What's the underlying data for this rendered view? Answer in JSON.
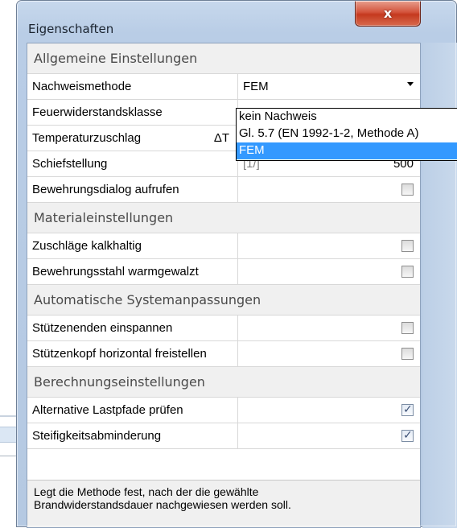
{
  "window": {
    "title": "Eigenschaften",
    "close_glyph": "x"
  },
  "sections": {
    "general": "Allgemeine Einstellungen",
    "material": "Materialeinstellungen",
    "auto": "Automatische Systemanpassungen",
    "calc": "Berechnungseinstellungen"
  },
  "rows": {
    "method": {
      "label": "Nachweismethode",
      "value": "FEM"
    },
    "fire_class": {
      "label": "Feuerwiderstandsklasse"
    },
    "temp": {
      "label": "Temperaturzuschlag",
      "symbol": "ΔT"
    },
    "tilt": {
      "label": "Schiefstellung",
      "unit": "[1/]",
      "value": "500"
    },
    "reinforcement_dialog": {
      "label": "Bewehrungsdialog aufrufen",
      "checked": false
    },
    "aggregates": {
      "label": "Zuschläge kalkhaltig",
      "checked": false
    },
    "steel": {
      "label": "Bewehrungsstahl warmgewalzt",
      "checked": false
    },
    "clamp": {
      "label": "Stützenenden einspannen",
      "checked": false
    },
    "release": {
      "label": "Stützenkopf horizontal freistellen",
      "checked": false
    },
    "alt_paths": {
      "label": "Alternative Lastpfade prüfen",
      "checked": true,
      "mark": "✓"
    },
    "stiffness": {
      "label": "Steifigkeitsabminderung",
      "checked": true,
      "mark": "✓"
    }
  },
  "dropdown": {
    "options": [
      "kein Nachweis",
      "Gl. 5.7 (EN 1992-1-2, Methode A)",
      "FEM"
    ],
    "selected": "FEM"
  },
  "description": {
    "line1": "Legt die Methode fest, nach der die gewählte",
    "line2": "Brandwiderstandsdauer nachgewiesen werden soll."
  },
  "colors": {
    "selection": "#3399ff",
    "section_bg": "#f0f0f0",
    "close_button": "#c4391e"
  }
}
